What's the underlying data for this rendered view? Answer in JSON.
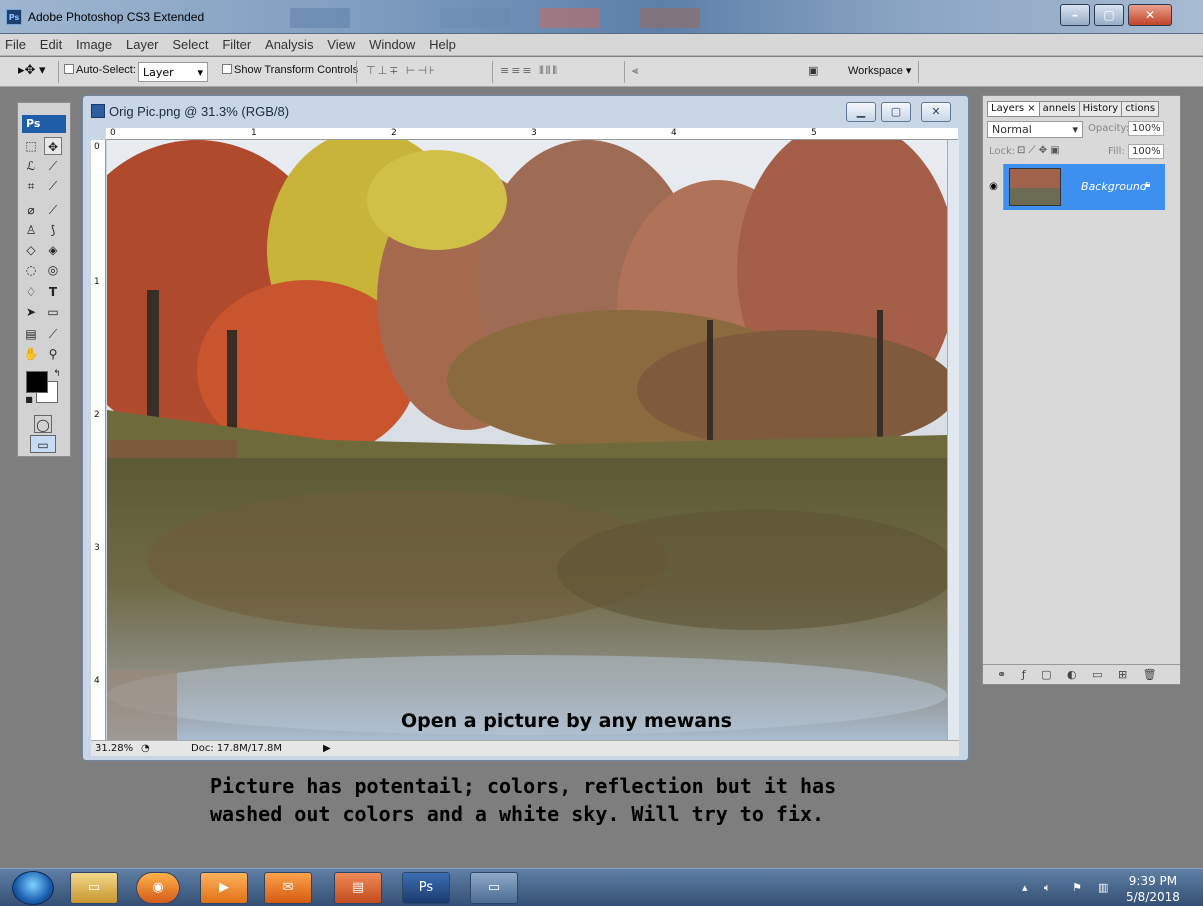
{
  "window": {
    "title": "Adobe Photoshop CS3 Extended",
    "logo": "Ps"
  },
  "menu": [
    "File",
    "Edit",
    "Image",
    "Layer",
    "Select",
    "Filter",
    "Analysis",
    "View",
    "Window",
    "Help"
  ],
  "options": {
    "auto_select_label": "Auto-Select:",
    "auto_select_value": "Layer",
    "show_transform_label": "Show Transform Controls",
    "workspace_label": "Workspace"
  },
  "tools": {
    "logo": "Ps"
  },
  "document": {
    "title": "Orig Pic.png @ 31.3% (RGB/8)",
    "ruler_h": [
      "0",
      "1",
      "2",
      "3",
      "4",
      "5"
    ],
    "ruler_v": [
      "0",
      "1",
      "2",
      "3",
      "4"
    ],
    "zoom": "31.28%",
    "doc_size": "Doc: 17.8M/17.8M"
  },
  "layers_panel": {
    "tabs": [
      "Layers ×",
      "annels",
      "History",
      "ctions"
    ],
    "blend_mode": "Normal",
    "opacity_label": "Opacity:",
    "opacity_value": "100%",
    "lock_label": "Lock:",
    "fill_label": "Fill:",
    "fill_value": "100%",
    "layer_name": "Background"
  },
  "annotations": {
    "inline": "Open a picture by any mewans",
    "line1": "Picture has potentail; colors, reflection but it has",
    "line2": "washed out colors and a white sky.  Will try to fix."
  },
  "taskbar": {
    "ps_label": "Ps",
    "time": "9:39 PM",
    "date": "5/8/2018"
  }
}
